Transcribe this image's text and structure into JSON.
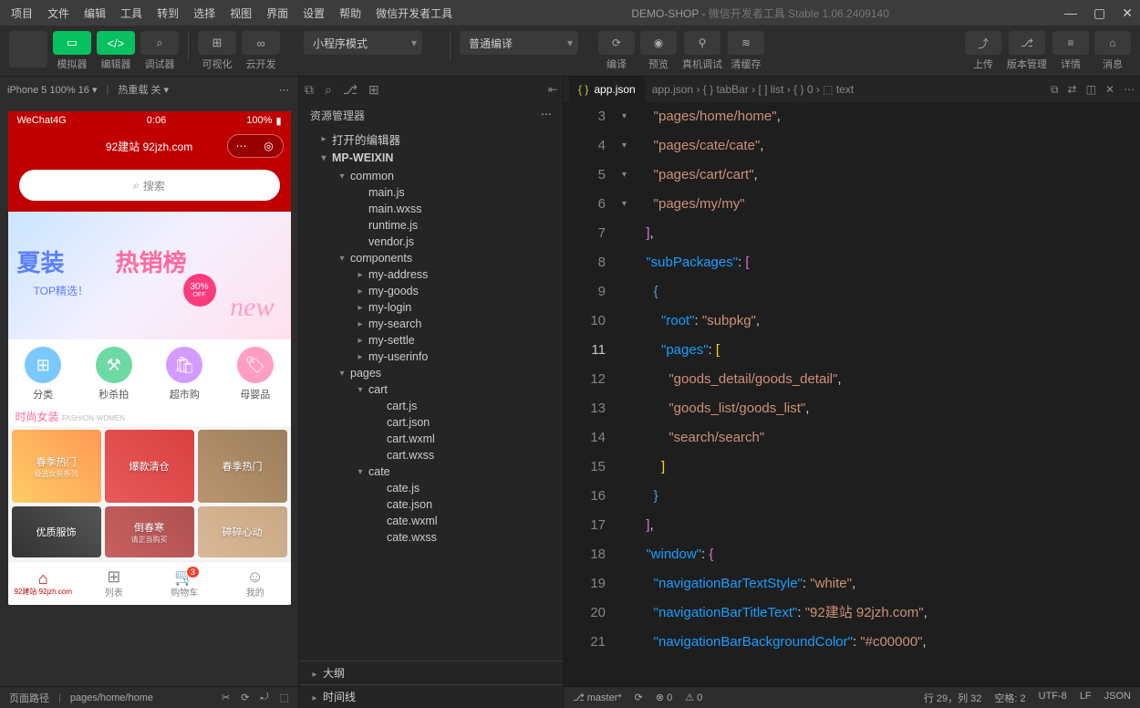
{
  "title": {
    "project": "DEMO-SHOP",
    "app": "微信开发者工具 Stable 1.06.2409140"
  },
  "menu": [
    "项目",
    "文件",
    "编辑",
    "工具",
    "转到",
    "选择",
    "视图",
    "界面",
    "设置",
    "帮助",
    "微信开发者工具"
  ],
  "toolbar": {
    "simulator": "模拟器",
    "editor": "编辑器",
    "debugger": "调试器",
    "visualize": "可视化",
    "clouddev": "云开发",
    "mode": "小程序模式",
    "compileMode": "普通编译",
    "compile": "编译",
    "preview": "预览",
    "realDebug": "真机调试",
    "clearCache": "清缓存",
    "upload": "上传",
    "version": "版本管理",
    "detail": "详情",
    "message": "消息"
  },
  "sim": {
    "device": "iPhone 5 100% 16",
    "hotreload": "热重载 关",
    "carrier": "WeChat4G",
    "time": "0:06",
    "battery": "100%",
    "navTitle": "92建站 92jzh.com",
    "searchPlaceholder": "搜索",
    "bannerTitle1": "夏装",
    "bannerTitle2": "热销榜",
    "bannerSub": "TOP精选！",
    "bannerSale": "30%",
    "bannerSaleOff": "OFF",
    "bannerNew": "new",
    "cats": [
      {
        "label": "分类"
      },
      {
        "label": "秒杀拍"
      },
      {
        "label": "超市购"
      },
      {
        "label": "母婴品"
      }
    ],
    "sectionTitle": "时尚女装",
    "sectionSub": "FASHION·WOMEN",
    "cards": [
      "春季热门",
      "爆款清仓",
      "春季热门",
      "优质服饰",
      "倒春寒",
      "碎碎心动"
    ],
    "cardSub": [
      "极选女装系列",
      "",
      "",
      "",
      "请正当购买",
      ""
    ],
    "tabs": [
      {
        "label": "92建站 92jzh.com",
        "badge": ""
      },
      {
        "label": "列表",
        "badge": ""
      },
      {
        "label": "购物车",
        "badge": "3"
      },
      {
        "label": "我的",
        "badge": ""
      }
    ]
  },
  "explorer": {
    "title": "资源管理器",
    "sections": {
      "openEditors": "打开的编辑器",
      "project": "MP-WEIXIN",
      "outline": "大纲",
      "timeline": "时间线"
    },
    "tree": [
      {
        "d": 2,
        "chev": "▾",
        "label": "common"
      },
      {
        "d": 3,
        "label": "main.js"
      },
      {
        "d": 3,
        "label": "main.wxss"
      },
      {
        "d": 3,
        "label": "runtime.js"
      },
      {
        "d": 3,
        "label": "vendor.js"
      },
      {
        "d": 2,
        "chev": "▾",
        "label": "components"
      },
      {
        "d": 3,
        "chev": "▸",
        "label": "my-address"
      },
      {
        "d": 3,
        "chev": "▸",
        "label": "my-goods"
      },
      {
        "d": 3,
        "chev": "▸",
        "label": "my-login"
      },
      {
        "d": 3,
        "chev": "▸",
        "label": "my-search"
      },
      {
        "d": 3,
        "chev": "▸",
        "label": "my-settle"
      },
      {
        "d": 3,
        "chev": "▸",
        "label": "my-userinfo"
      },
      {
        "d": 2,
        "chev": "▾",
        "label": "pages"
      },
      {
        "d": 3,
        "chev": "▾",
        "label": "cart"
      },
      {
        "d": 4,
        "label": "cart.js"
      },
      {
        "d": 4,
        "label": "cart.json"
      },
      {
        "d": 4,
        "label": "cart.wxml"
      },
      {
        "d": 4,
        "label": "cart.wxss"
      },
      {
        "d": 3,
        "chev": "▾",
        "label": "cate"
      },
      {
        "d": 4,
        "label": "cate.js"
      },
      {
        "d": 4,
        "label": "cate.json"
      },
      {
        "d": 4,
        "label": "cate.wxml"
      },
      {
        "d": 4,
        "label": "cate.wxss"
      }
    ]
  },
  "editor": {
    "activeTab": "app.json",
    "breadcrumb": "app.json › { } tabBar › [ ] list › { } 0 › ⬚ text",
    "lines": [
      {
        "n": 3,
        "seg": [
          [
            "p",
            "    "
          ],
          [
            "s",
            "\"pages/home/home\""
          ],
          [
            "p",
            ","
          ]
        ]
      },
      {
        "n": 4,
        "seg": [
          [
            "p",
            "    "
          ],
          [
            "s",
            "\"pages/cate/cate\""
          ],
          [
            "p",
            ","
          ]
        ]
      },
      {
        "n": 5,
        "seg": [
          [
            "p",
            "    "
          ],
          [
            "s",
            "\"pages/cart/cart\""
          ],
          [
            "p",
            ","
          ]
        ]
      },
      {
        "n": 6,
        "seg": [
          [
            "p",
            "    "
          ],
          [
            "s",
            "\"pages/my/my\""
          ]
        ]
      },
      {
        "n": 7,
        "seg": [
          [
            "p",
            "  "
          ],
          [
            "pb",
            "]"
          ],
          [
            "p",
            ","
          ]
        ]
      },
      {
        "n": 8,
        "fold": "▾",
        "seg": [
          [
            "p",
            "  "
          ],
          [
            "b",
            "\"subPackages\""
          ],
          [
            "p",
            ": "
          ],
          [
            "pb",
            "["
          ]
        ]
      },
      {
        "n": 9,
        "fold": "▾",
        "seg": [
          [
            "p",
            "    "
          ],
          [
            "bb",
            "{"
          ]
        ]
      },
      {
        "n": 10,
        "seg": [
          [
            "p",
            "      "
          ],
          [
            "b",
            "\"root\""
          ],
          [
            "p",
            ": "
          ],
          [
            "s",
            "\"subpkg\""
          ],
          [
            "p",
            ","
          ]
        ]
      },
      {
        "n": 11,
        "fold": "▾",
        "seg": [
          [
            "p",
            "      "
          ],
          [
            "b",
            "\"pages\""
          ],
          [
            "p",
            ": "
          ],
          [
            "y",
            "["
          ]
        ]
      },
      {
        "n": 12,
        "seg": [
          [
            "p",
            "        "
          ],
          [
            "s",
            "\"goods_detail/goods_detail\""
          ],
          [
            "p",
            ","
          ]
        ]
      },
      {
        "n": 13,
        "seg": [
          [
            "p",
            "        "
          ],
          [
            "s",
            "\"goods_list/goods_list\""
          ],
          [
            "p",
            ","
          ]
        ]
      },
      {
        "n": 14,
        "seg": [
          [
            "p",
            "        "
          ],
          [
            "s",
            "\"search/search\""
          ]
        ]
      },
      {
        "n": 15,
        "seg": [
          [
            "p",
            "      "
          ],
          [
            "y",
            "]"
          ]
        ]
      },
      {
        "n": 16,
        "seg": [
          [
            "p",
            "    "
          ],
          [
            "bb",
            "}"
          ]
        ]
      },
      {
        "n": 17,
        "seg": [
          [
            "p",
            "  "
          ],
          [
            "pb",
            "]"
          ],
          [
            "p",
            ","
          ]
        ]
      },
      {
        "n": 18,
        "fold": "▾",
        "seg": [
          [
            "p",
            "  "
          ],
          [
            "b",
            "\"window\""
          ],
          [
            "p",
            ": "
          ],
          [
            "pb",
            "{"
          ]
        ]
      },
      {
        "n": 19,
        "seg": [
          [
            "p",
            "    "
          ],
          [
            "b",
            "\"navigationBarTextStyle\""
          ],
          [
            "p",
            ": "
          ],
          [
            "s",
            "\"white\""
          ],
          [
            "p",
            ","
          ]
        ]
      },
      {
        "n": 20,
        "seg": [
          [
            "p",
            "    "
          ],
          [
            "b",
            "\"navigationBarTitleText\""
          ],
          [
            "p",
            ": "
          ],
          [
            "s",
            "\"92建站 92jzh.com\""
          ],
          [
            "p",
            ","
          ]
        ]
      },
      {
        "n": 21,
        "seg": [
          [
            "p",
            "    "
          ],
          [
            "b",
            "\"navigationBarBackgroundColor\""
          ],
          [
            "p",
            ": "
          ],
          [
            "s",
            "\"#c00000\""
          ],
          [
            "p",
            ","
          ]
        ]
      }
    ]
  },
  "statusSim": {
    "path": "页面路径",
    "route": "pages/home/home"
  },
  "statusBottom": {
    "branch": "master*",
    "sync": "⟳",
    "err": "⊗ 0",
    "warn": "⚠ 0",
    "pos": "行 29，列 32",
    "spaces": "空格: 2",
    "enc": "UTF-8",
    "eol": "LF",
    "lang": "JSON"
  }
}
